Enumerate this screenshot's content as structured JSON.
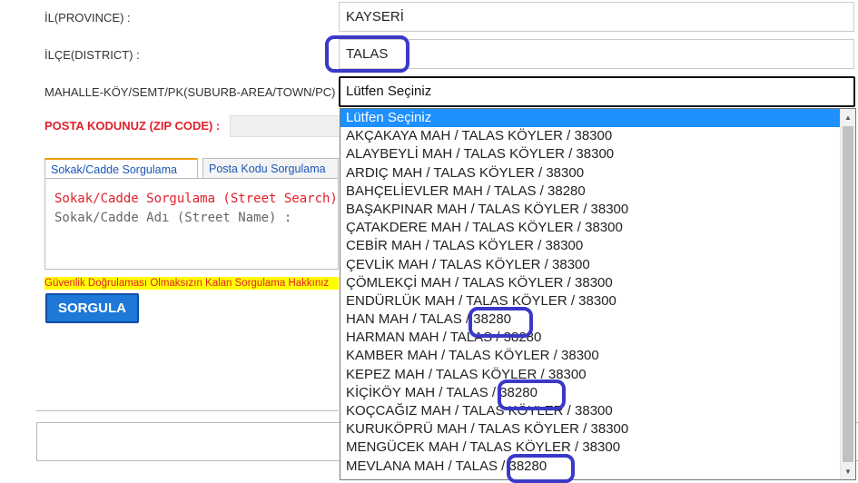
{
  "form": {
    "province_label": "İL(PROVINCE) :",
    "province_value": "KAYSERİ",
    "district_label": "İLÇE(DISTRICT) :",
    "district_value": "TALAS",
    "suburb_label": "MAHALLE-KÖY/SEMT/PK(SUBURB-AREA/TOWN/PC) :",
    "suburb_value": "Lütfen Seçiniz",
    "zip_label": "POSTA KODUNUZ (ZIP CODE) :"
  },
  "tabs": [
    {
      "label": "Sokak/Cadde Sorgulama"
    },
    {
      "label": "Posta Kodu Sorgulama"
    }
  ],
  "panel": {
    "title": "Sokak/Cadde Sorgulama (Street Search)",
    "street_label": "Sokak/Cadde Adı (Street Name) :"
  },
  "warning": "Güvenlik Doğrulaması Olmaksızın Kalan Sorgulama Hakkınız",
  "search_button": "SORGULA",
  "dropdown": {
    "options": [
      "Lütfen Seçiniz",
      "AKÇAKAYA MAH / TALAS KÖYLER / 38300",
      "ALAYBEYLİ MAH / TALAS KÖYLER / 38300",
      "ARDIÇ MAH / TALAS KÖYLER / 38300",
      "BAHÇELİEVLER MAH / TALAS / 38280",
      "BAŞAKPINAR MAH / TALAS KÖYLER / 38300",
      "ÇATAKDERE MAH / TALAS KÖYLER / 38300",
      "CEBİR MAH / TALAS KÖYLER / 38300",
      "ÇEVLİK MAH / TALAS KÖYLER / 38300",
      "ÇÖMLEKÇİ MAH / TALAS KÖYLER / 38300",
      "ENDÜRLÜK MAH / TALAS KÖYLER / 38300",
      "HAN MAH / TALAS / 38280",
      "HARMAN MAH / TALAS / 38280",
      "KAMBER MAH / TALAS KÖYLER / 38300",
      "KEPEZ MAH / TALAS KÖYLER / 38300",
      "KİÇİKÖY MAH / TALAS / 38280",
      "KOÇCAĞIZ MAH / TALAS KÖYLER / 38300",
      "KURUKÖPRÜ MAH / TALAS KÖYLER / 38300",
      "MENGÜCEK MAH / TALAS KÖYLER / 38300",
      "MEVLANA MAH / TALAS / 38280"
    ]
  },
  "annotation_color": "#3a39c8",
  "icons": {
    "scroll_up": "triangle-up",
    "scroll_down": "triangle-down"
  }
}
